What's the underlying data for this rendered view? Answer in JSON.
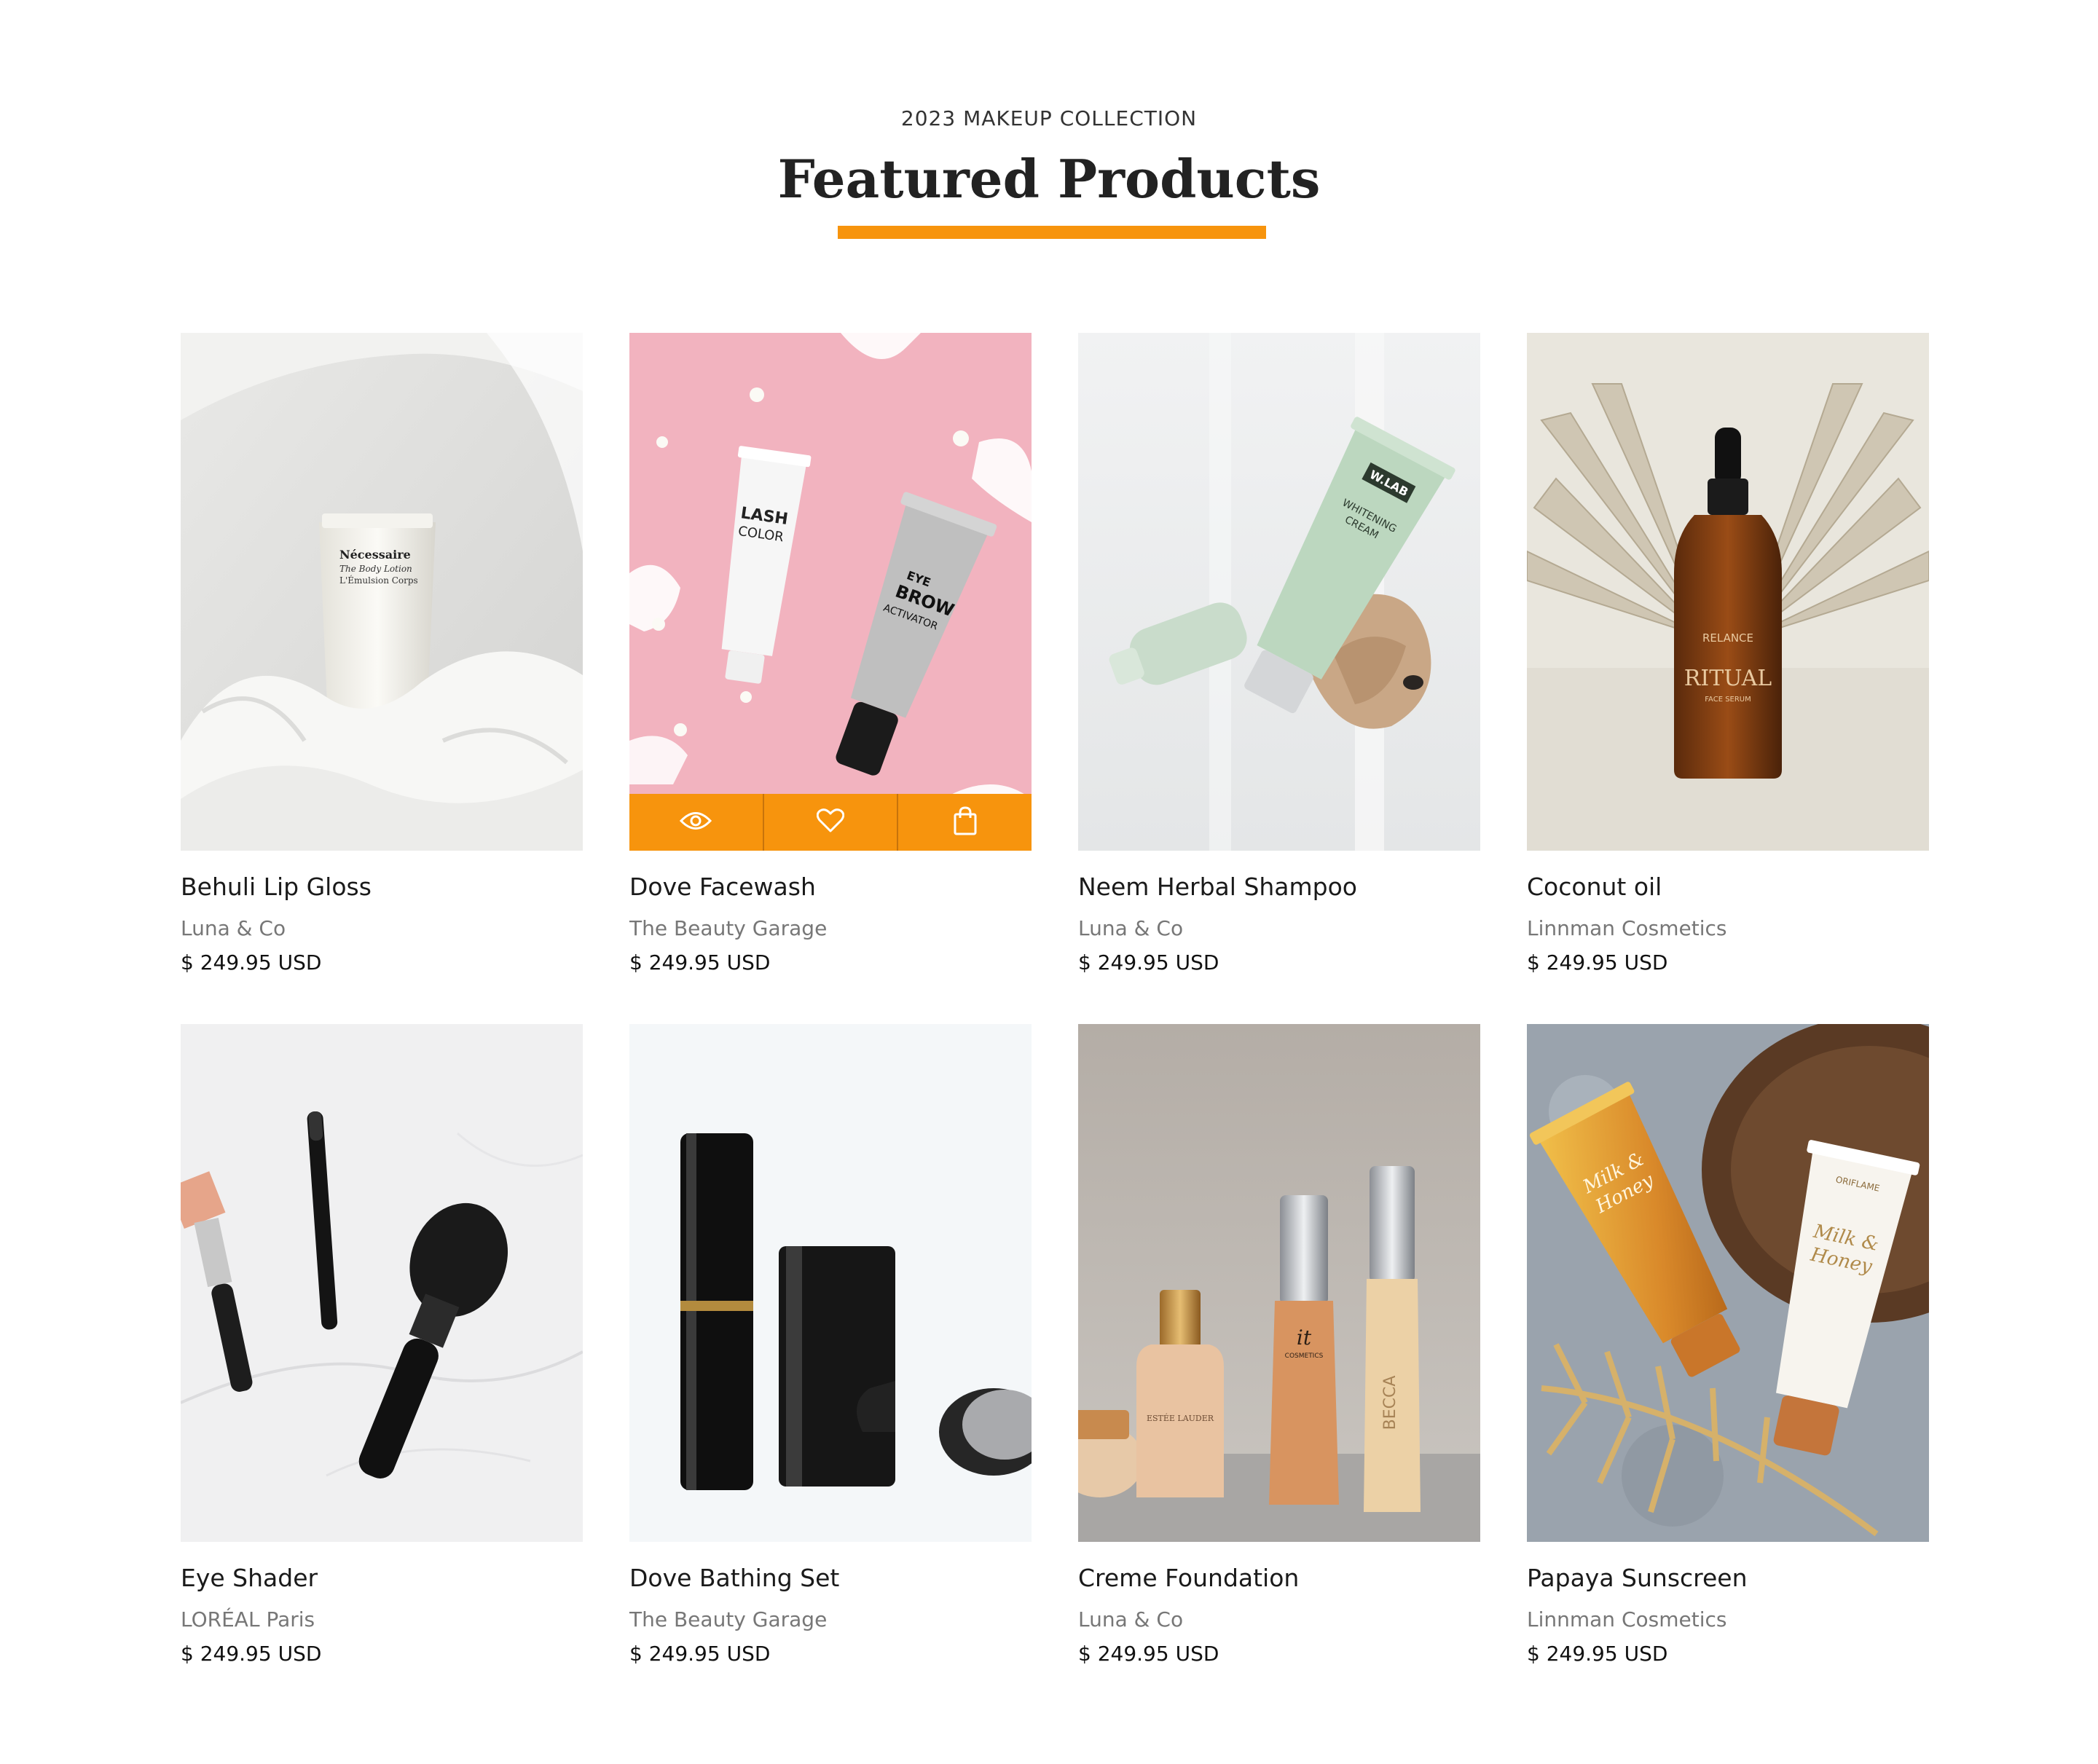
{
  "header": {
    "eyebrow": "2023 MAKEUP COLLECTION",
    "title": "Featured Products",
    "accent_color": "#f7940d"
  },
  "hover_actions": {
    "quick_view_icon": "eye-icon",
    "wishlist_icon": "heart-icon",
    "add_to_cart_icon": "shopping-bag-icon"
  },
  "products": [
    {
      "name": "Behuli Lip Gloss",
      "brand": "Luna & Co",
      "price": "$ 249.95 USD",
      "image": "white lotion tube on white fabric",
      "tube_text": "Nécessaire\nThe Body Lotion\nL'Émulsion Corps"
    },
    {
      "name": "Dove Facewash",
      "brand": "The Beauty Garage",
      "price": "$ 249.95 USD",
      "image": "two tubes on pink background",
      "tube_text_a": "LASH\nCOLOR",
      "tube_text_b": "EYE\nBROW\nACTIVATOR"
    },
    {
      "name": "Neem Herbal Shampoo",
      "brand": "Luna & Co",
      "price": "$ 249.95 USD",
      "image": "green cream tube with stone",
      "tube_text": "W.LAB",
      "tube_text_b": "WHITENING\nCREAM"
    },
    {
      "name": "Coconut oil",
      "brand": "Linnman Cosmetics",
      "price": "$ 249.95 USD",
      "image": "amber dropper bottle with paper fans",
      "bottle_text": "RELANCE",
      "bottle_text_b": "RITUAL",
      "bottle_text_c": "FACE SERUM"
    },
    {
      "name": "Eye Shader",
      "brand": "LORÉAL Paris",
      "price": "$ 249.95 USD",
      "image": "makeup brushes on marble"
    },
    {
      "name": "Dove Bathing Set",
      "brand": "The Beauty Garage",
      "price": "$ 249.95 USD",
      "image": "black cosmetic containers"
    },
    {
      "name": "Creme Foundation",
      "brand": "Luna & Co",
      "price": "$ 249.95 USD",
      "image": "foundation bottles",
      "bottle_text": "ESTÉE LAUDER",
      "bottle_text_b": "it COSMETICS",
      "bottle_text_c": "BECCA"
    },
    {
      "name": "Papaya Sunscreen",
      "brand": "Linnman Cosmetics",
      "price": "$ 249.95 USD",
      "image": "golden tubes with palm leaf",
      "tube_text": "Milk & Honey",
      "tube_text_b": "ORIFLAME"
    }
  ]
}
